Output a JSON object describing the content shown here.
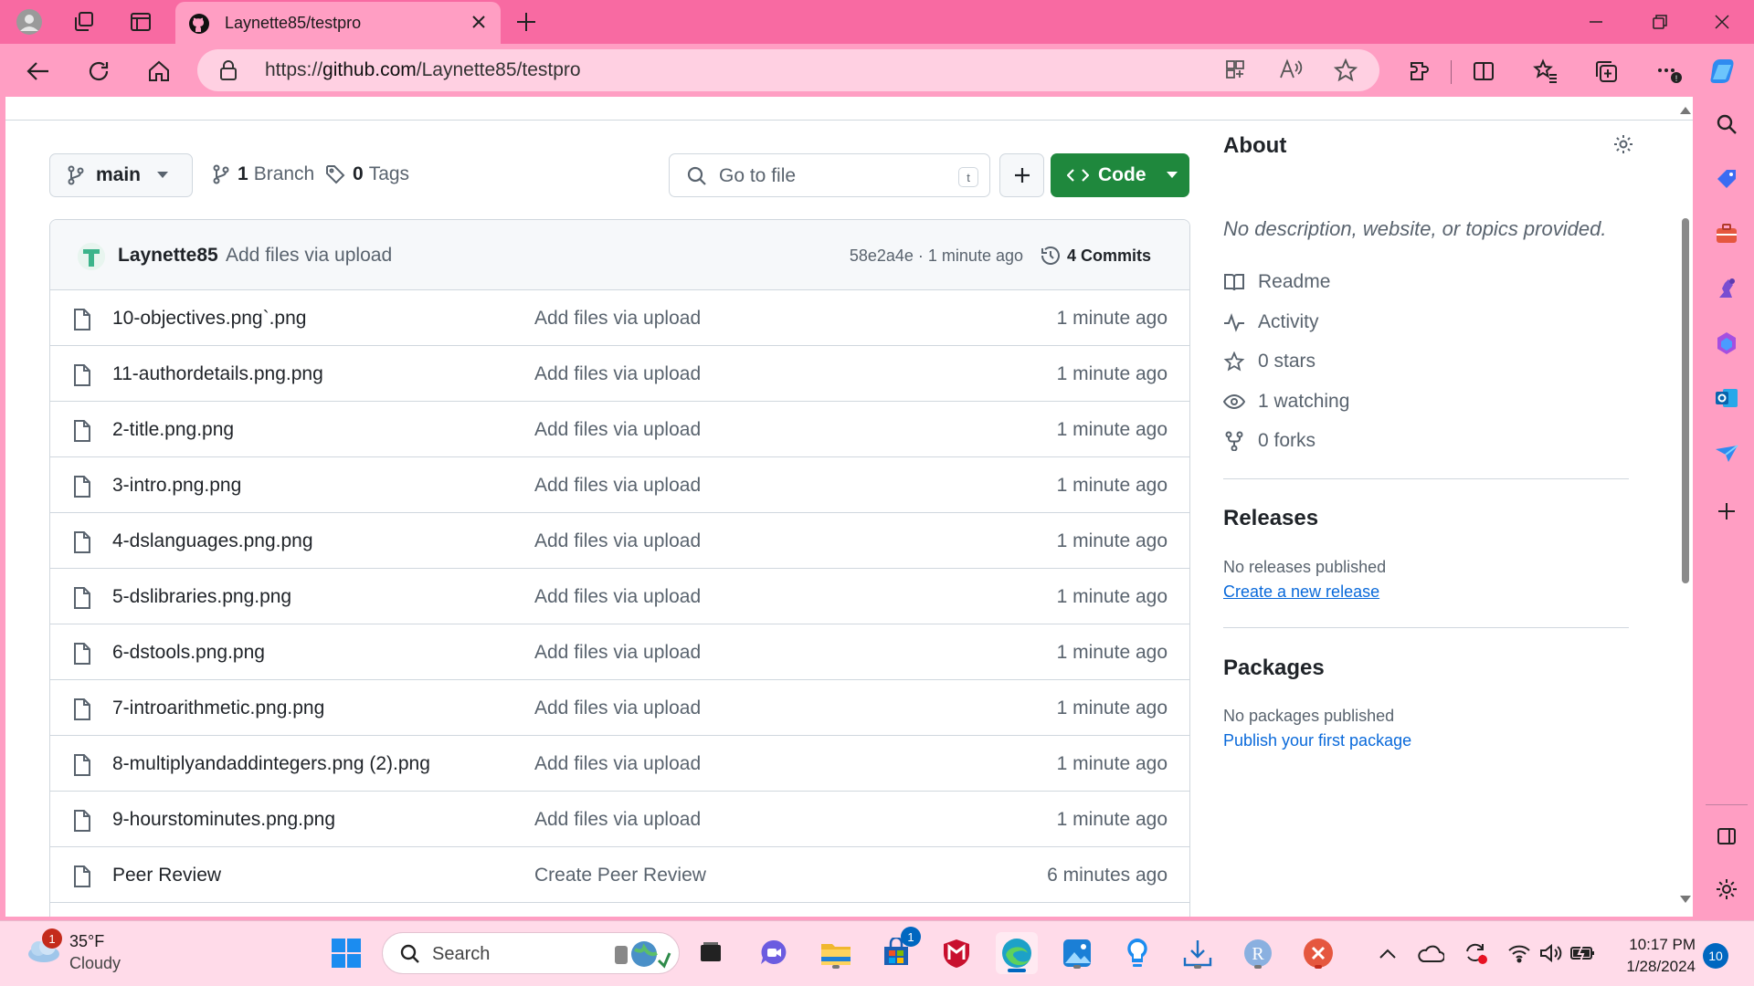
{
  "browser": {
    "tab_title": "Laynette85/testpro",
    "url_prefix": "https://",
    "url_host": "github.com",
    "url_path": "/Laynette85/testpro",
    "accent_color": "#f86aa2"
  },
  "repo": {
    "branch": "main",
    "branches_count": "1",
    "branches_label": "Branch",
    "tags_count": "0",
    "tags_label": "Tags",
    "goto_placeholder": "Go to file",
    "goto_shortcut": "t",
    "code_label": "Code"
  },
  "latest_commit": {
    "author": "Laynette85",
    "message": "Add files via upload",
    "sha_time": "58e2a4e · 1 minute ago",
    "commits_label": "4 Commits"
  },
  "files": [
    {
      "name": "10-objectives.png`.png",
      "message": "Add files via upload",
      "age": "1 minute ago"
    },
    {
      "name": "11-authordetails.png.png",
      "message": "Add files via upload",
      "age": "1 minute ago"
    },
    {
      "name": "2-title.png.png",
      "message": "Add files via upload",
      "age": "1 minute ago"
    },
    {
      "name": "3-intro.png.png",
      "message": "Add files via upload",
      "age": "1 minute ago"
    },
    {
      "name": "4-dslanguages.png.png",
      "message": "Add files via upload",
      "age": "1 minute ago"
    },
    {
      "name": "5-dslibraries.png.png",
      "message": "Add files via upload",
      "age": "1 minute ago"
    },
    {
      "name": "6-dstools.png.png",
      "message": "Add files via upload",
      "age": "1 minute ago"
    },
    {
      "name": "7-introarithmetic.png.png",
      "message": "Add files via upload",
      "age": "1 minute ago"
    },
    {
      "name": "8-multiplyandaddintegers.png (2).png",
      "message": "Add files via upload",
      "age": "1 minute ago"
    },
    {
      "name": "9-hourstominutes.png.png",
      "message": "Add files via upload",
      "age": "1 minute ago"
    },
    {
      "name": "Peer Review",
      "message": "Create Peer Review",
      "age": "6 minutes ago"
    }
  ],
  "about": {
    "title": "About",
    "description": "No description, website, or topics provided.",
    "readme": "Readme",
    "activity": "Activity",
    "stars": "0 stars",
    "watching": "1 watching",
    "forks": "0 forks"
  },
  "releases": {
    "title": "Releases",
    "status": "No releases published",
    "link": "Create a new release"
  },
  "packages": {
    "title": "Packages",
    "status": "No packages published",
    "link": "Publish your first package"
  },
  "taskbar": {
    "temperature": "35°F",
    "condition": "Cloudy",
    "weather_badge": "1",
    "search_label": "Search",
    "store_badge": "1",
    "time": "10:17 PM",
    "date": "1/28/2024",
    "notifications": "10"
  }
}
